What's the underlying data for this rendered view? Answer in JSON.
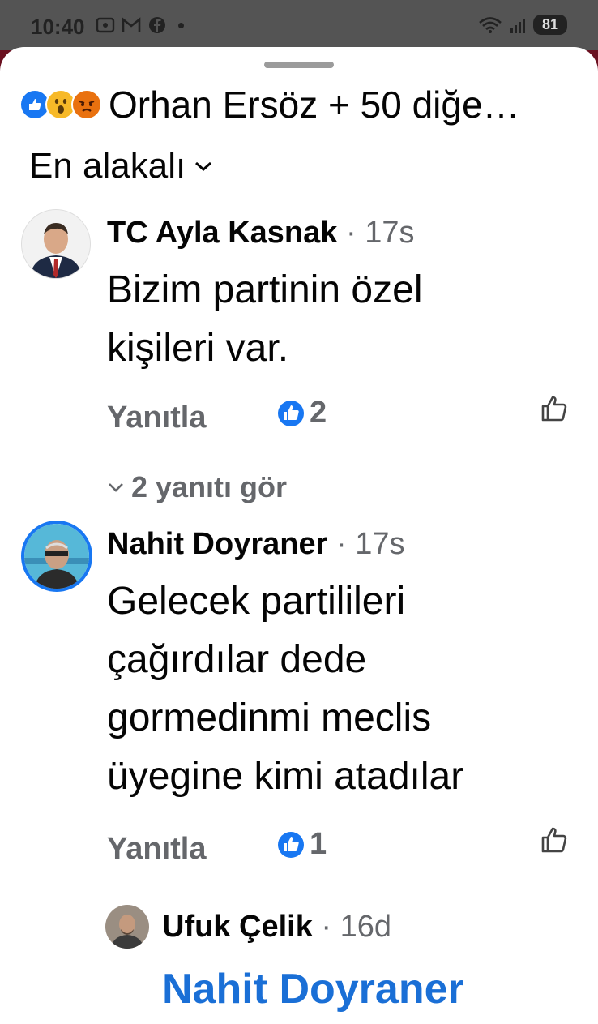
{
  "status_bar": {
    "time": "10:40",
    "left_icons": [
      "screenshot-icon",
      "gmail-icon",
      "facebook-icon",
      "dot-icon"
    ],
    "right_icons": [
      "wifi-icon",
      "signal-icon"
    ],
    "battery": "81"
  },
  "header": {
    "reaction_icons": [
      "like",
      "wow",
      "angry"
    ],
    "reactions_text": "Orhan Ersöz + 50 diğe…",
    "sort_label": "En alakalı"
  },
  "comments": [
    {
      "author": "TC Ayla Kasnak",
      "time": "17s",
      "text_lines": [
        "Bizim partinin özel",
        "kişileri var."
      ],
      "reply_label": "Yanıtla",
      "like_count": "2",
      "see_replies": "2 yanıtı gör"
    },
    {
      "author": "Nahit Doyraner",
      "time": "17s",
      "text_lines": [
        "Gelecek partilileri",
        "çağırdılar dede",
        "gormedinmi meclis",
        "üyegine kimi atadılar"
      ],
      "reply_label": "Yanıtla",
      "like_count": "1"
    }
  ],
  "reply": {
    "author": "Ufuk Çelik",
    "time": "16d",
    "mention": "Nahit Doyraner"
  },
  "colors": {
    "accent": "#1a6fd6",
    "like_blue": "#1877f2",
    "secondary_text": "#65676b",
    "status_bar_bg": "#545454"
  }
}
